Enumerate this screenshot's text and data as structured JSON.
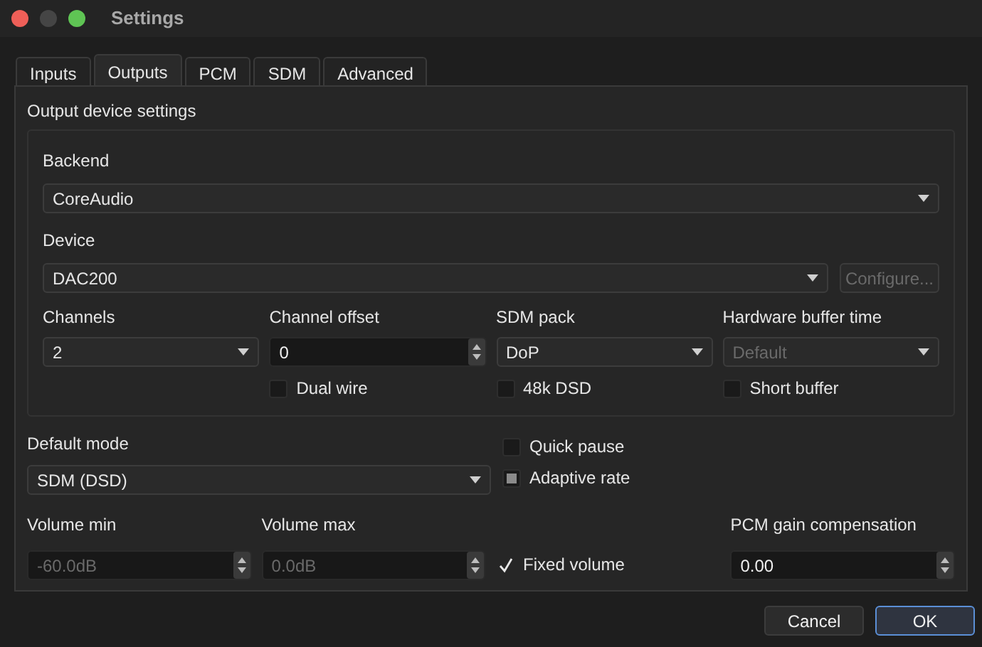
{
  "window": {
    "title": "Settings"
  },
  "tabs": [
    {
      "label": "Inputs",
      "selected": false
    },
    {
      "label": "Outputs",
      "selected": true
    },
    {
      "label": "PCM",
      "selected": false
    },
    {
      "label": "SDM",
      "selected": false
    },
    {
      "label": "Advanced",
      "selected": false
    }
  ],
  "device_group": {
    "title": "Output device settings",
    "backend": {
      "label": "Backend",
      "value": "CoreAudio"
    },
    "device": {
      "label": "Device",
      "value": "DAC200",
      "button": "Configure...",
      "button_disabled": true
    },
    "columns": [
      {
        "label": "Channels",
        "control": {
          "kind": "combo",
          "value": "2",
          "disabled": false
        }
      },
      {
        "label": "Channel offset",
        "control": {
          "kind": "spin",
          "value": "0",
          "disabled": false
        },
        "checkbox": {
          "label": "Dual wire",
          "checked": false,
          "partial": false
        }
      },
      {
        "label": "SDM pack",
        "control": {
          "kind": "combo",
          "value": "DoP",
          "disabled": false
        },
        "checkbox": {
          "label": "48k DSD",
          "checked": false,
          "partial": false
        }
      },
      {
        "label": "Hardware buffer time",
        "control": {
          "kind": "combo",
          "value": "Default",
          "disabled": true
        },
        "checkbox": {
          "label": "Short buffer",
          "checked": false,
          "partial": false
        }
      }
    ]
  },
  "default_mode": {
    "label": "Default mode",
    "value": "SDM (DSD)"
  },
  "quick_pause": {
    "label": "Quick pause",
    "checked": false,
    "partial": false
  },
  "adaptive_rate": {
    "label": "Adaptive rate",
    "checked": false,
    "partial": true
  },
  "volume_min": {
    "label": "Volume min",
    "value": "-60.0dB",
    "disabled": true
  },
  "volume_max": {
    "label": "Volume max",
    "value": "0.0dB",
    "disabled": true
  },
  "fixed_volume": {
    "label": "Fixed volume",
    "checked": true,
    "partial": false
  },
  "pcm_gain": {
    "label": "PCM gain compensation",
    "value": "0.00",
    "disabled": false
  },
  "buttons": [
    {
      "label": "Cancel",
      "default": false
    },
    {
      "label": "OK",
      "default": true
    }
  ]
}
